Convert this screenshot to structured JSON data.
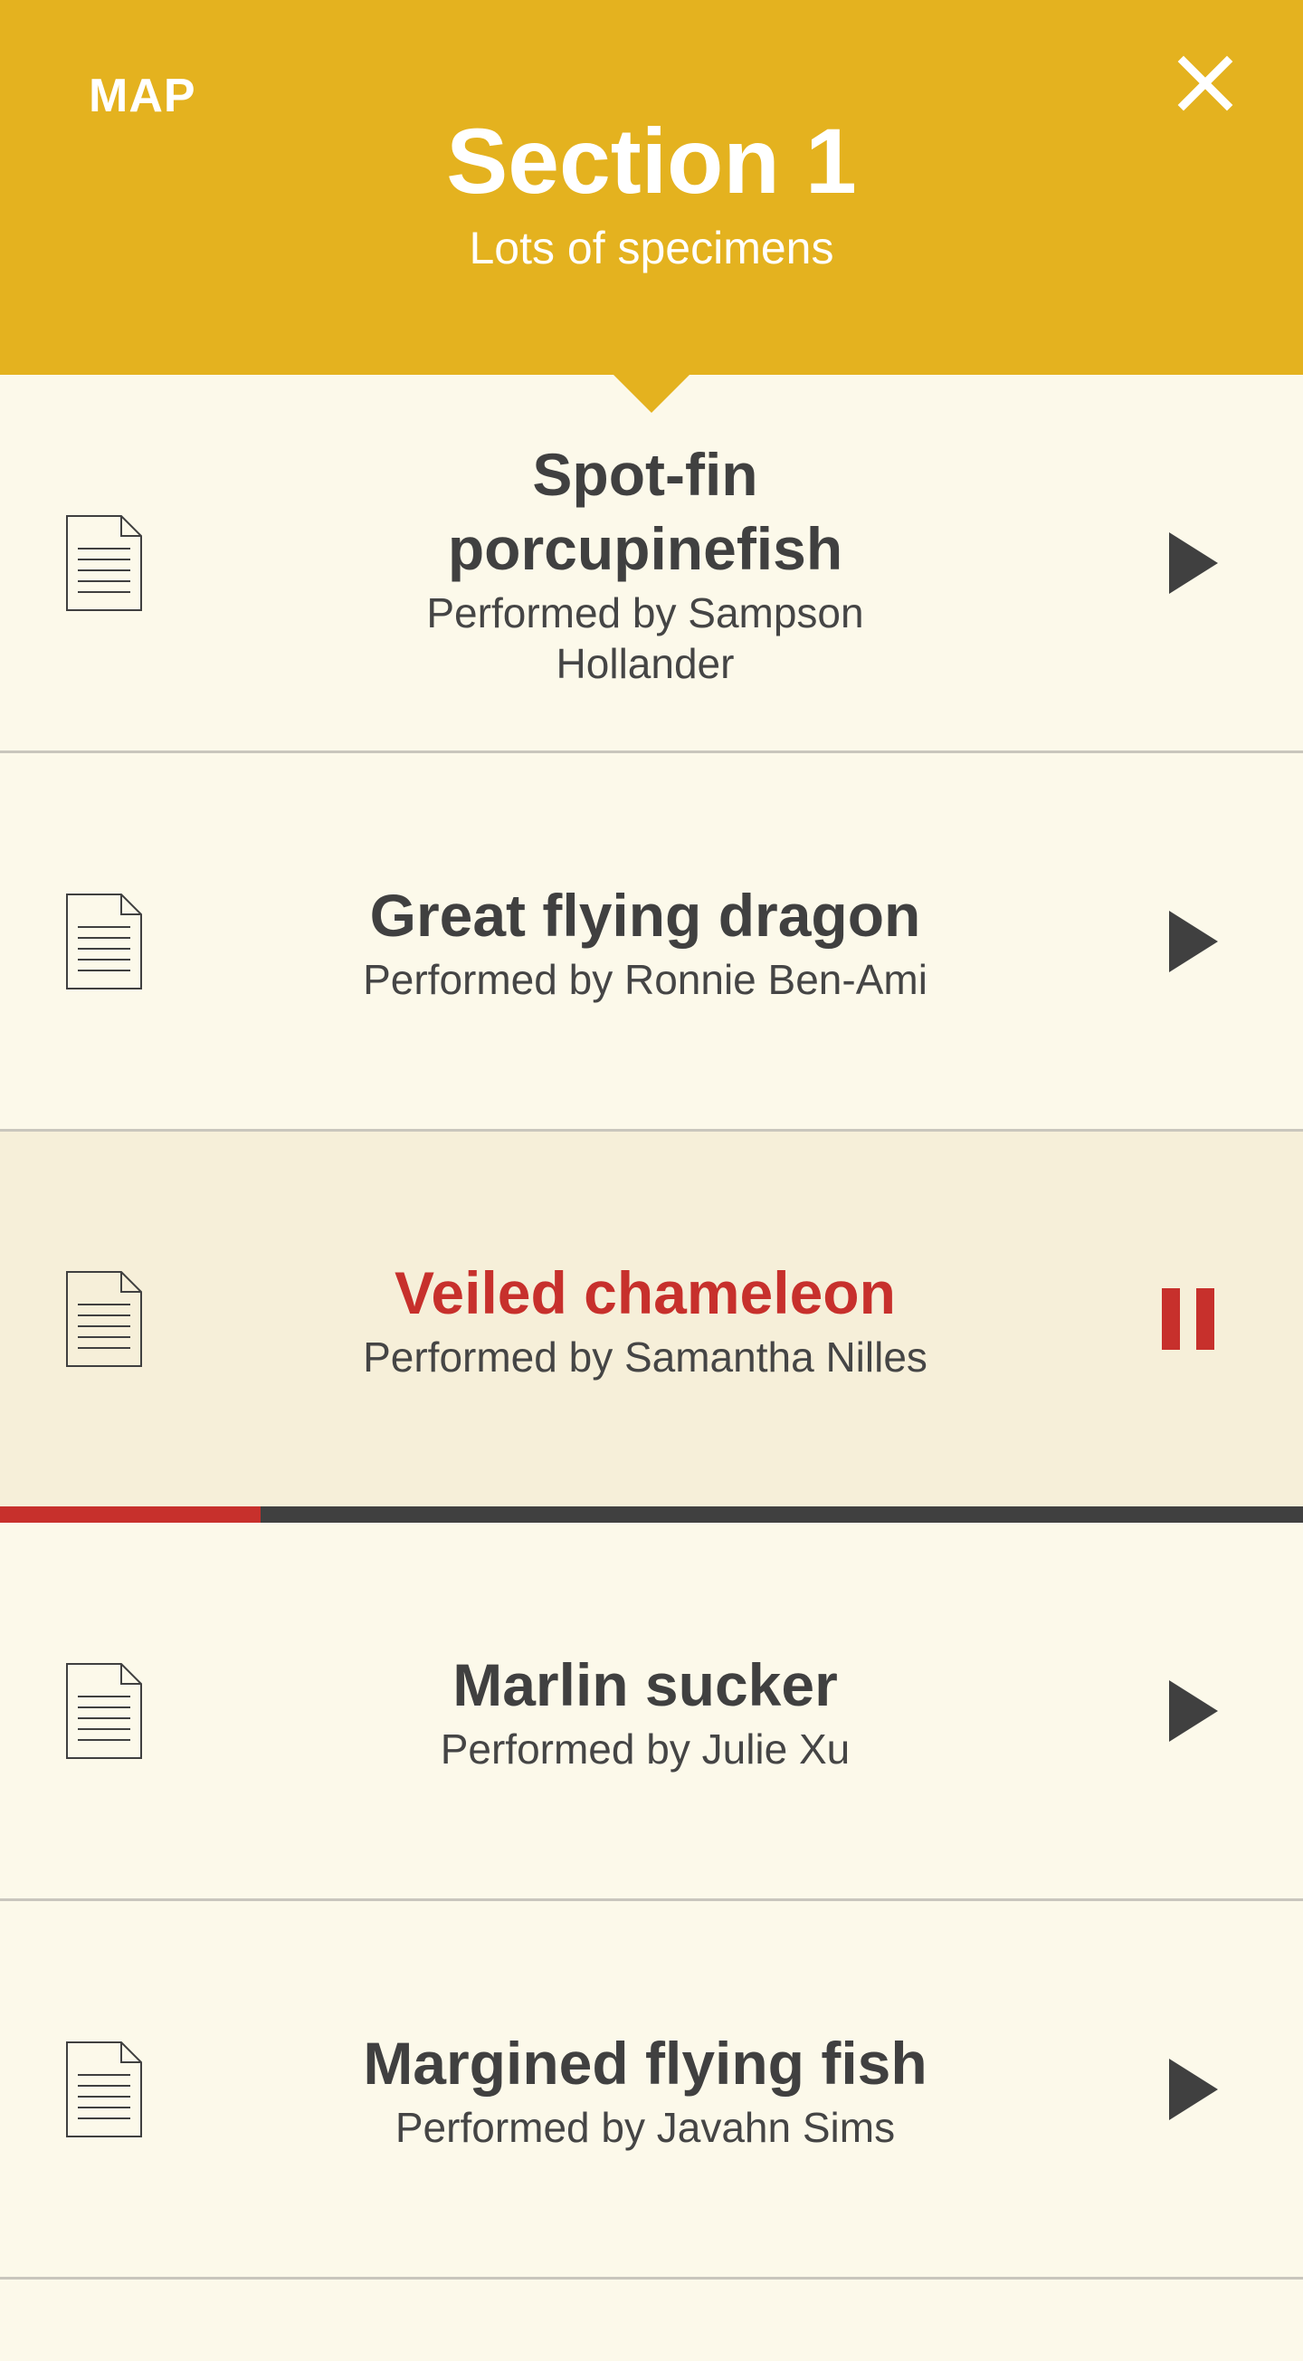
{
  "header": {
    "map_label": "MAP",
    "close_icon": "close-icon",
    "title": "Section 1",
    "subtitle": "Lots of specimens",
    "background_color": "#e4b21f"
  },
  "colors": {
    "background": "#fcf9ea",
    "active_row_background": "#f6efd9",
    "active_accent": "#c7302c",
    "text": "#404040",
    "divider": "#c9c6bd"
  },
  "tracks": [
    {
      "title": "Spot-fin porcupinefish",
      "performer": "Performed by Sampson Hollander",
      "state": "stopped",
      "icon": "play-icon"
    },
    {
      "title": "Great flying dragon",
      "performer": "Performed by Ronnie Ben-Ami",
      "state": "stopped",
      "icon": "play-icon"
    },
    {
      "title": "Veiled chameleon",
      "performer": "Performed by Samantha Nilles",
      "state": "playing",
      "icon": "pause-icon",
      "progress_fraction": 0.2
    },
    {
      "title": "Marlin sucker",
      "performer": "Performed by Julie Xu",
      "state": "stopped",
      "icon": "play-icon"
    },
    {
      "title": "Margined flying fish",
      "performer": "Performed by Javahn Sims",
      "state": "stopped",
      "icon": "play-icon"
    }
  ]
}
